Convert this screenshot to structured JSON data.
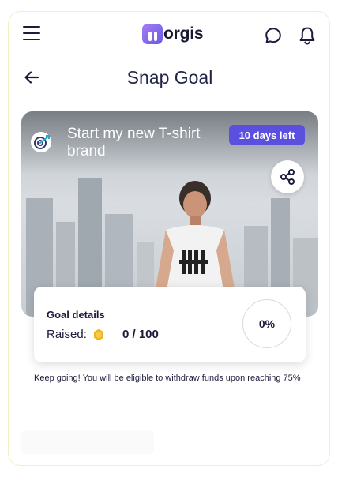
{
  "app": {
    "logo_text": "orgis"
  },
  "header": {
    "title": "Snap Goal"
  },
  "goal": {
    "title": "Start my new T-shirt brand",
    "days_left": "10 days left"
  },
  "details": {
    "title": "Goal details",
    "raised_label": "Raised:",
    "raised_value": "0 / 100",
    "progress_text": "0%",
    "progress": 0
  },
  "note": "Keep going! You will be eligible to withdraw funds upon reaching 75%",
  "colors": {
    "accent": "#5b4fe0",
    "logo_gradient_start": "#a77cf5",
    "logo_gradient_end": "#6a5ae0",
    "coin": "#f2b21a"
  },
  "icons": [
    "menu-icon",
    "chat-icon",
    "bell-icon",
    "back-arrow-icon",
    "target-icon",
    "share-icon",
    "coin-icon"
  ]
}
